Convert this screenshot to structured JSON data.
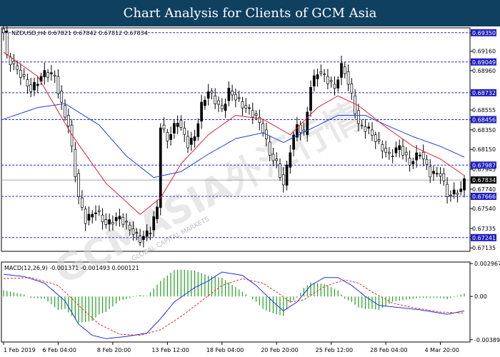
{
  "banner": {
    "title": "Chart Analysis for Clients of GCM Asia"
  },
  "header": {
    "info": "NZDUSD,H4  0.67821 0.67842 0.67812 0.67834",
    "macd_info": "MACD(12,26,9) -0.001371 -0.001493 0.000121"
  },
  "watermark": {
    "text": "GCMASIA外汇行情",
    "sub": "GLOBAL CAPITAL MARKETS"
  },
  "colors": {
    "banner": "#0f4060",
    "level_line": "#2a2ac8",
    "level_box": "#1f1fc0",
    "current_box": "#000000",
    "bull": "#000000",
    "bear": "#ffffff",
    "ma_fast": "#e02030",
    "ma_slow": "#2040e0",
    "macd_line": "#2030e0",
    "signal_line": "#e03030",
    "histogram": "#20a020"
  },
  "chart_data": [
    {
      "type": "candlestick",
      "symbol": "NZDUSD",
      "timeframe": "H4",
      "ylim": [
        0.671,
        0.694
      ],
      "yticks": [
        "0.69350",
        "0.69160",
        "0.69049",
        "0.68960",
        "0.68732",
        "0.68555",
        "0.68456",
        "0.68350",
        "0.68150",
        "0.67945",
        "0.67987",
        "0.67834",
        "0.67740",
        "0.67666",
        "0.67540",
        "0.67335",
        "0.67241",
        "0.67135"
      ],
      "ytick_values": [
        0.6935,
        0.6916,
        0.69049,
        0.6896,
        0.68732,
        0.68555,
        0.68456,
        0.6835,
        0.6815,
        0.67945,
        0.67987,
        0.67834,
        0.6774,
        0.67666,
        0.6754,
        0.67335,
        0.67241,
        0.67135
      ],
      "levels": [
        0.6935,
        0.69049,
        0.68732,
        0.68456,
        0.67987,
        0.67666,
        0.67241
      ],
      "current_price": 0.67834,
      "xtick_labels": [
        "1 Feb 2019",
        "6 Feb 04:00",
        "8 Feb 20:00",
        "13 Feb 12:00",
        "18 Feb 04:00",
        "20 Feb 20:00",
        "25 Feb 12:00",
        "28 Feb 04:00",
        "4 Mar 20:00"
      ],
      "xtick_index": [
        0,
        16,
        32,
        48,
        64,
        80,
        96,
        112,
        128
      ],
      "anchors": [
        [
          0,
          0.6935
        ],
        [
          1,
          0.691
        ],
        [
          5,
          0.6892
        ],
        [
          8,
          0.6876
        ],
        [
          12,
          0.6894
        ],
        [
          15,
          0.689
        ],
        [
          17,
          0.686
        ],
        [
          19,
          0.684
        ],
        [
          22,
          0.6765
        ],
        [
          24,
          0.6742
        ],
        [
          27,
          0.6752
        ],
        [
          30,
          0.6738
        ],
        [
          34,
          0.6745
        ],
        [
          37,
          0.6733
        ],
        [
          40,
          0.6722
        ],
        [
          43,
          0.6732
        ],
        [
          45,
          0.6755
        ],
        [
          46,
          0.684
        ],
        [
          48,
          0.6825
        ],
        [
          51,
          0.6845
        ],
        [
          54,
          0.682
        ],
        [
          56,
          0.6828
        ],
        [
          58,
          0.686
        ],
        [
          60,
          0.6875
        ],
        [
          62,
          0.6865
        ],
        [
          64,
          0.6855
        ],
        [
          66,
          0.6875
        ],
        [
          68,
          0.6868
        ],
        [
          70,
          0.686
        ],
        [
          72,
          0.6855
        ],
        [
          74,
          0.6848
        ],
        [
          76,
          0.6835
        ],
        [
          78,
          0.681
        ],
        [
          80,
          0.68
        ],
        [
          82,
          0.6778
        ],
        [
          84,
          0.6815
        ],
        [
          86,
          0.684
        ],
        [
          88,
          0.683
        ],
        [
          90,
          0.688
        ],
        [
          92,
          0.6895
        ],
        [
          94,
          0.689
        ],
        [
          97,
          0.6878
        ],
        [
          99,
          0.69
        ],
        [
          100,
          0.6895
        ],
        [
          102,
          0.687
        ],
        [
          104,
          0.684
        ],
        [
          107,
          0.6835
        ],
        [
          110,
          0.682
        ],
        [
          113,
          0.6808
        ],
        [
          116,
          0.6818
        ],
        [
          119,
          0.68
        ],
        [
          122,
          0.6812
        ],
        [
          125,
          0.679
        ],
        [
          128,
          0.679
        ],
        [
          130,
          0.6768
        ],
        [
          132,
          0.677
        ],
        [
          134,
          0.6773
        ],
        [
          135,
          0.6783
        ]
      ],
      "ma_fast_anchors": [
        [
          0,
          0.6915
        ],
        [
          10,
          0.689
        ],
        [
          20,
          0.683
        ],
        [
          30,
          0.678
        ],
        [
          40,
          0.6748
        ],
        [
          46,
          0.6765
        ],
        [
          52,
          0.68
        ],
        [
          60,
          0.683
        ],
        [
          68,
          0.685
        ],
        [
          76,
          0.6846
        ],
        [
          84,
          0.683
        ],
        [
          92,
          0.6858
        ],
        [
          98,
          0.687
        ],
        [
          104,
          0.686
        ],
        [
          112,
          0.6838
        ],
        [
          120,
          0.6818
        ],
        [
          128,
          0.6805
        ],
        [
          135,
          0.6788
        ]
      ],
      "ma_slow_anchors": [
        [
          0,
          0.6846
        ],
        [
          10,
          0.6858
        ],
        [
          18,
          0.6862
        ],
        [
          28,
          0.684
        ],
        [
          36,
          0.6808
        ],
        [
          44,
          0.6786
        ],
        [
          52,
          0.6792
        ],
        [
          60,
          0.681
        ],
        [
          68,
          0.6826
        ],
        [
          76,
          0.6832
        ],
        [
          82,
          0.6822
        ],
        [
          90,
          0.6836
        ],
        [
          98,
          0.685
        ],
        [
          106,
          0.685
        ],
        [
          112,
          0.684
        ],
        [
          120,
          0.6828
        ],
        [
          128,
          0.6818
        ],
        [
          135,
          0.6807
        ]
      ]
    },
    {
      "type": "macd",
      "params": [
        12,
        26,
        9
      ],
      "values": {
        "main": -0.001371,
        "signal": -0.001493,
        "histogram": 0.000121
      },
      "ylim": [
        -0.0041,
        0.0031
      ],
      "yticks": [
        "0.002967",
        "0.00",
        "-0.003895"
      ],
      "ytick_values": [
        0.002967,
        0.0,
        -0.003895
      ],
      "macd_anchors": [
        [
          0,
          0.002
        ],
        [
          6,
          0.0018
        ],
        [
          12,
          0.0012
        ],
        [
          18,
          -0.0004
        ],
        [
          22,
          -0.0025
        ],
        [
          26,
          -0.0035
        ],
        [
          30,
          -0.0038
        ],
        [
          36,
          -0.0036
        ],
        [
          42,
          -0.0033
        ],
        [
          46,
          -0.002
        ],
        [
          50,
          -0.0005
        ],
        [
          56,
          0.0008
        ],
        [
          60,
          0.0014
        ],
        [
          64,
          0.0022
        ],
        [
          70,
          0.0019
        ],
        [
          74,
          0.001
        ],
        [
          78,
          -0.0002
        ],
        [
          82,
          -0.0013
        ],
        [
          86,
          -0.0005
        ],
        [
          90,
          0.001
        ],
        [
          94,
          0.0017
        ],
        [
          98,
          0.0017
        ],
        [
          102,
          0.001
        ],
        [
          106,
          0.0
        ],
        [
          110,
          -0.0008
        ],
        [
          116,
          -0.001
        ],
        [
          122,
          -0.0012
        ],
        [
          130,
          -0.0016
        ],
        [
          135,
          -0.0013
        ]
      ],
      "signal_anchors": [
        [
          0,
          0.0016
        ],
        [
          8,
          0.0017
        ],
        [
          16,
          0.001
        ],
        [
          22,
          -0.0008
        ],
        [
          28,
          -0.0025
        ],
        [
          34,
          -0.0034
        ],
        [
          40,
          -0.0035
        ],
        [
          46,
          -0.003
        ],
        [
          52,
          -0.0018
        ],
        [
          58,
          -0.0004
        ],
        [
          64,
          0.001
        ],
        [
          70,
          0.0016
        ],
        [
          76,
          0.0012
        ],
        [
          80,
          0.0004
        ],
        [
          84,
          -0.0005
        ],
        [
          88,
          -0.0003
        ],
        [
          94,
          0.0009
        ],
        [
          100,
          0.0015
        ],
        [
          104,
          0.0012
        ],
        [
          108,
          0.0004
        ],
        [
          114,
          -0.0006
        ],
        [
          120,
          -0.001
        ],
        [
          128,
          -0.0014
        ],
        [
          135,
          -0.0015
        ]
      ]
    }
  ]
}
